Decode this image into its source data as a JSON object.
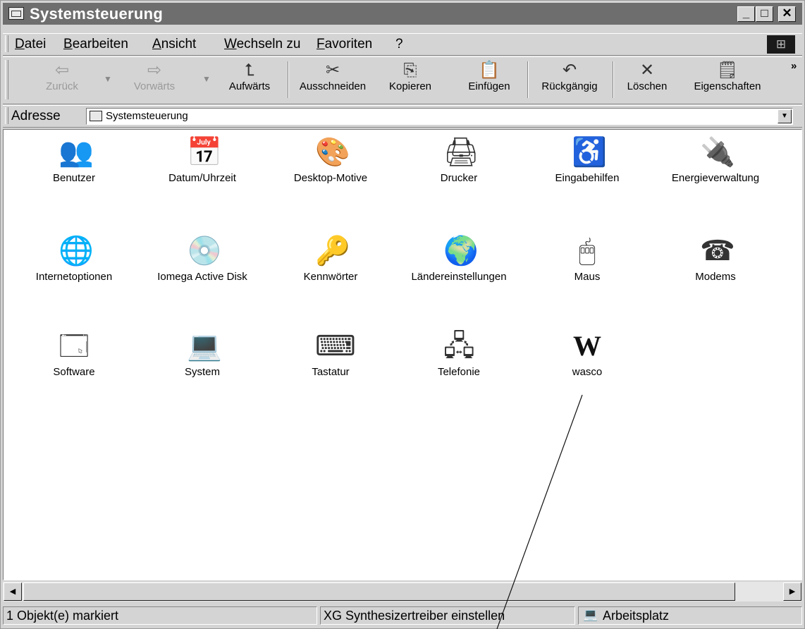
{
  "window": {
    "title": "Systemsteuerung"
  },
  "menu": [
    "Datei",
    "Bearbeiten",
    "Ansicht",
    "Wechseln zu",
    "Favoriten",
    "?"
  ],
  "toolbar": [
    {
      "label": "Zurück",
      "icon": "back-arrow-icon",
      "glyph": "⇦"
    },
    {
      "label": "Vorwärts",
      "icon": "forward-arrow-icon",
      "glyph": "⇨"
    },
    {
      "label": "Aufwärts",
      "icon": "up-folder-icon",
      "glyph": "⮤"
    },
    {
      "label": "Ausschneiden",
      "icon": "scissors-icon",
      "glyph": "✂"
    },
    {
      "label": "Kopieren",
      "icon": "copy-icon",
      "glyph": "⎘"
    },
    {
      "label": "Einfügen",
      "icon": "paste-icon",
      "glyph": "📋"
    },
    {
      "label": "Rückgängig",
      "icon": "undo-icon",
      "glyph": "↶"
    },
    {
      "label": "Löschen",
      "icon": "delete-x-icon",
      "glyph": "✕"
    },
    {
      "label": "Eigenschaften",
      "icon": "properties-icon",
      "glyph": "🗒"
    }
  ],
  "address": {
    "label": "Adresse",
    "value": "Systemsteuerung"
  },
  "items": [
    {
      "label": "Benutzer",
      "icon": "users-icon",
      "glyph": "👥"
    },
    {
      "label": "Datum/Uhrzeit",
      "icon": "date-time-icon",
      "glyph": "📅"
    },
    {
      "label": "Desktop-Motive",
      "icon": "desktop-themes-icon",
      "glyph": "🎨"
    },
    {
      "label": "Drucker",
      "icon": "printer-folder-icon",
      "glyph": "🖨"
    },
    {
      "label": "Eingabehilfen",
      "icon": "accessibility-icon",
      "glyph": "♿"
    },
    {
      "label": "Energieverwaltung",
      "icon": "power-management-icon",
      "glyph": "🔌"
    },
    {
      "label": "Internetoptionen",
      "icon": "internet-options-icon",
      "glyph": "🌐"
    },
    {
      "label": "Iomega Active Disk",
      "icon": "iomega-disk-icon",
      "glyph": "💿"
    },
    {
      "label": "Kennwörter",
      "icon": "keys-icon",
      "glyph": "🔑"
    },
    {
      "label": "Ländereinstellungen",
      "icon": "globe-icon",
      "glyph": "🌍"
    },
    {
      "label": "Maus",
      "icon": "mouse-icon",
      "glyph": "🖱"
    },
    {
      "label": "Modems",
      "icon": "modem-phone-icon",
      "glyph": "☎"
    },
    {
      "label": "Software",
      "icon": "software-icon",
      "glyph": "🗔"
    },
    {
      "label": "System",
      "icon": "computer-icon",
      "glyph": "💻"
    },
    {
      "label": "Tastatur",
      "icon": "keyboard-icon",
      "glyph": "⌨"
    },
    {
      "label": "Telefonie",
      "icon": "telephony-network-icon",
      "glyph": "🖧"
    },
    {
      "label": "wasco",
      "icon": "wasco-w-icon",
      "glyph": "W"
    }
  ],
  "status": {
    "selection": "1 Objekt(e) markiert",
    "description": "XG Synthesizertreiber einstellen",
    "zone": "Arbeitsplatz"
  }
}
